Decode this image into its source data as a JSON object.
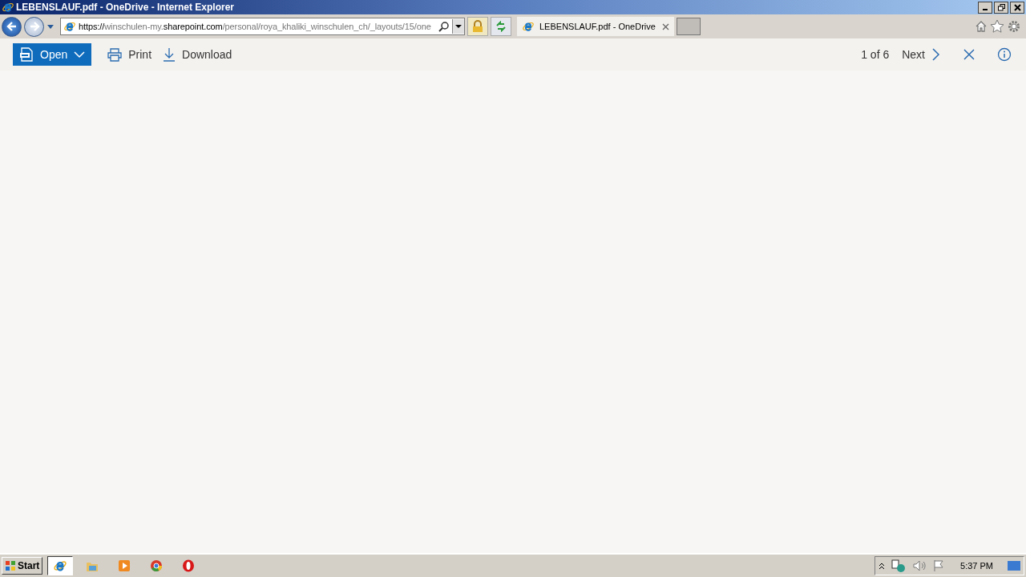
{
  "window": {
    "title": "LEBENSLAUF.pdf - OneDrive - Internet Explorer"
  },
  "address_bar": {
    "url_parts": [
      {
        "text": "https://",
        "dim": false
      },
      {
        "text": "winschulen-my.",
        "dim": true
      },
      {
        "text": "sharepoint.com",
        "dim": false
      },
      {
        "text": "/personal/roya_khaliki_winschulen_ch/_layouts/15/one",
        "dim": true
      }
    ]
  },
  "tabs": [
    {
      "label": "LEBENSLAUF.pdf - OneDrive",
      "selected": true
    }
  ],
  "toolbar": {
    "open": "Open",
    "print": "Print",
    "download": "Download",
    "page_count": "1 of 6",
    "next": "Next"
  },
  "taskbar": {
    "start": "Start",
    "apps": [
      {
        "kind": "ie",
        "selected": true
      },
      {
        "kind": "folder",
        "selected": false
      },
      {
        "kind": "media",
        "selected": false
      },
      {
        "kind": "chrome",
        "selected": false
      },
      {
        "kind": "opera",
        "selected": false
      }
    ],
    "clock": "5:37 PM"
  }
}
